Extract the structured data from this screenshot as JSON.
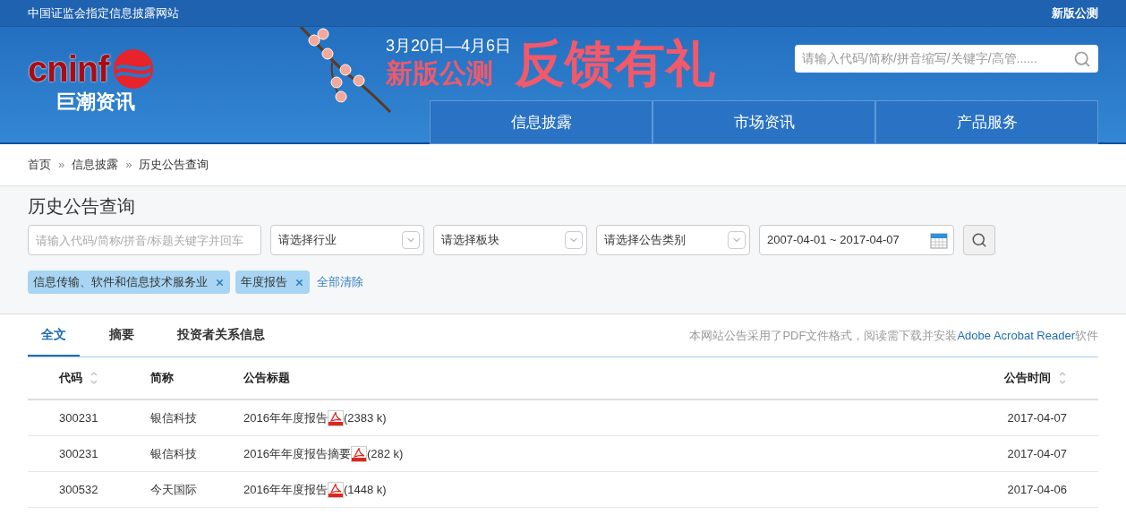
{
  "top_bar": {
    "tagline": "中国证监会指定信息披露网站",
    "beta_link": "新版公测"
  },
  "header": {
    "logo": {
      "wordmark": "cninf",
      "name": "巨潮资讯"
    },
    "banner": {
      "dates": "3月20日—4月6日",
      "slogan": "新版公测",
      "headline": "反馈有礼"
    },
    "search": {
      "placeholder": "请输入代码/简称/拼音缩写/关键字/高管......"
    },
    "nav": [
      {
        "label": "信息披露",
        "selected": false
      },
      {
        "label": "市场资讯",
        "selected": false
      },
      {
        "label": "产品服务",
        "selected": false
      }
    ]
  },
  "breadcrumb": {
    "items": [
      "首页",
      "信息披露",
      "历史公告查询"
    ],
    "separators": [
      "»",
      "»"
    ]
  },
  "filters": {
    "title": "历史公告查询",
    "keyword": {
      "placeholder": "请输入代码/简称/拼音/标题关键字并回车"
    },
    "selects": [
      {
        "placeholder": "请选择行业"
      },
      {
        "placeholder": "请选择板块"
      },
      {
        "placeholder": "请选择公告类别"
      }
    ],
    "date_range": "2007-04-01 ~ 2017-04-07",
    "tags": [
      "信息传输、软件和信息技术服务业",
      "年度报告"
    ],
    "clear_all": "全部清除"
  },
  "tabs": [
    {
      "label": "全文",
      "selected": true
    },
    {
      "label": "摘要",
      "selected": false
    },
    {
      "label": "投资者关系信息",
      "selected": false
    }
  ],
  "notice": {
    "text": "本网站公告采用了PDF文件格式，阅读需下载并安装",
    "link": "Adobe Acrobat Reader",
    "suffix": "软件"
  },
  "table": {
    "columns": [
      {
        "label": "代码",
        "sortable": true
      },
      {
        "label": "简称",
        "sortable": false
      },
      {
        "label": "公告标题",
        "sortable": false
      },
      {
        "label": "公告时间",
        "sortable": true
      }
    ],
    "rows": [
      {
        "code": "300231",
        "name": "银信科技",
        "title": "2016年年度报告",
        "size": "(2383 k)",
        "date": "2017-04-07"
      },
      {
        "code": "300231",
        "name": "银信科技",
        "title": "2016年年度报告摘要",
        "size": "(282 k)",
        "date": "2017-04-07"
      },
      {
        "code": "300532",
        "name": "今天国际",
        "title": "2016年年度报告",
        "size": "(1448 k)",
        "date": "2017-04-06"
      }
    ]
  }
}
